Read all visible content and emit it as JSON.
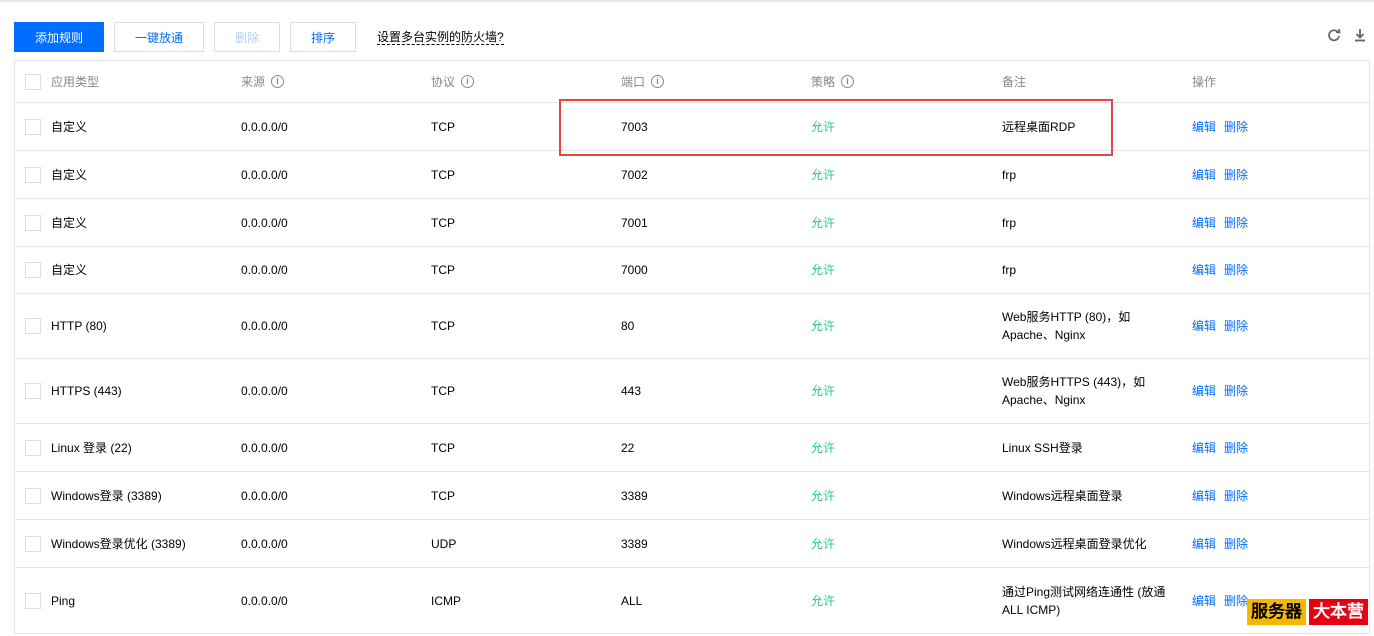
{
  "toolbar": {
    "add_rule": "添加规则",
    "open_all": "一键放通",
    "delete": "删除",
    "sort": "排序",
    "help_link": "设置多台实例的防火墙?"
  },
  "icons": {
    "refresh": "refresh-icon",
    "download": "download-icon",
    "info": "info-icon"
  },
  "colors": {
    "primary": "#006eff",
    "allow": "#29cc85",
    "highlight": "#e54545"
  },
  "table": {
    "headers": {
      "type": "应用类型",
      "source": "来源",
      "protocol": "协议",
      "port": "端口",
      "policy": "策略",
      "remark": "备注",
      "ops": "操作"
    },
    "op_edit": "编辑",
    "op_delete": "删除",
    "rows": [
      {
        "type": "自定义",
        "source": "0.0.0.0/0",
        "protocol": "TCP",
        "port": "7003",
        "policy": "允许",
        "remark": "远程桌面RDP"
      },
      {
        "type": "自定义",
        "source": "0.0.0.0/0",
        "protocol": "TCP",
        "port": "7002",
        "policy": "允许",
        "remark": "frp"
      },
      {
        "type": "自定义",
        "source": "0.0.0.0/0",
        "protocol": "TCP",
        "port": "7001",
        "policy": "允许",
        "remark": "frp"
      },
      {
        "type": "自定义",
        "source": "0.0.0.0/0",
        "protocol": "TCP",
        "port": "7000",
        "policy": "允许",
        "remark": "frp"
      },
      {
        "type": "HTTP (80)",
        "source": "0.0.0.0/0",
        "protocol": "TCP",
        "port": "80",
        "policy": "允许",
        "remark": "Web服务HTTP (80)，如Apache、Nginx"
      },
      {
        "type": "HTTPS (443)",
        "source": "0.0.0.0/0",
        "protocol": "TCP",
        "port": "443",
        "policy": "允许",
        "remark": "Web服务HTTPS (443)，如Apache、Nginx"
      },
      {
        "type": "Linux 登录 (22)",
        "source": "0.0.0.0/0",
        "protocol": "TCP",
        "port": "22",
        "policy": "允许",
        "remark": "Linux SSH登录"
      },
      {
        "type": "Windows登录 (3389)",
        "source": "0.0.0.0/0",
        "protocol": "TCP",
        "port": "3389",
        "policy": "允许",
        "remark": "Windows远程桌面登录"
      },
      {
        "type": "Windows登录优化 (3389)",
        "source": "0.0.0.0/0",
        "protocol": "UDP",
        "port": "3389",
        "policy": "允许",
        "remark": "Windows远程桌面登录优化"
      },
      {
        "type": "Ping",
        "source": "0.0.0.0/0",
        "protocol": "ICMP",
        "port": "ALL",
        "policy": "允许",
        "remark": "通过Ping测试网络连通性 (放通ALL ICMP)"
      }
    ]
  },
  "watermark": {
    "part1": "服务器",
    "part2": "大本营"
  }
}
